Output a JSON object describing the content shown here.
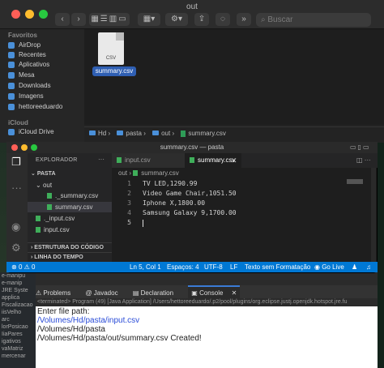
{
  "finder": {
    "title": "out",
    "search_placeholder": "Buscar",
    "sidebar_heading_favorites": "Favoritos",
    "favorites": [
      "AirDrop",
      "Recentes",
      "Aplicativos",
      "Mesa",
      "Downloads",
      "Imagens",
      "hettoreeduardo"
    ],
    "sidebar_heading_icloud": "iCloud",
    "icloud_items": [
      "iCloud Drive"
    ],
    "file_name": "summary.csv",
    "file_ext": "CSV",
    "path": [
      "Hd",
      "pasta",
      "out",
      "summary.csv"
    ]
  },
  "vscode": {
    "title": "summary.csv — pasta",
    "explorer": {
      "heading": "EXPLORADOR",
      "root": "PASTA",
      "tree": [
        {
          "label": "out",
          "type": "folder"
        },
        {
          "label": "._summary.csv",
          "type": "file"
        },
        {
          "label": "summary.csv",
          "type": "file"
        },
        {
          "label": "._input.csv",
          "type": "file"
        },
        {
          "label": "input.csv",
          "type": "file"
        }
      ],
      "outline": "ESTRUTURA DO CÓDIGO",
      "timeline": "LINHA DO TEMPO"
    },
    "tabs": [
      {
        "label": "input.csv",
        "active": false
      },
      {
        "label": "summary.csv",
        "active": true
      }
    ],
    "breadcrumb": [
      "out",
      "summary.csv"
    ],
    "lines": [
      "TV LED,1290.99",
      "Video Game Chair,1051.50",
      "Iphone X,1800.00",
      "Samsung Galaxy 9,1700.00",
      ""
    ],
    "line_numbers": [
      "1",
      "2",
      "3",
      "4",
      "5"
    ],
    "status": {
      "errors": "0",
      "warnings": "0",
      "position": "Ln 5, Col 1",
      "spaces": "Espaços: 4",
      "encoding": "UTF-8",
      "eol": "LF",
      "language": "Texto sem Formatação",
      "golive": "Go Live"
    }
  },
  "eclipse": {
    "tabs": [
      "Problems",
      "Javadoc",
      "Declaration",
      "Console"
    ],
    "active_tab": "Console",
    "terminated": "<terminated> Program (49) [Java Application] /Users/hettoreeduardo/.p2/pool/plugins/org.eclipse.justj.openjdk.hotspot.jre.fu",
    "console_lines": [
      "Enter file path:",
      "/Volumes/Hd/pasta/input.csv",
      "/Volumes/Hd/pasta",
      "/Volumes/Hd/pasta/out/summary.csv Created!"
    ],
    "left_panel_lines": [
      "e-manipu",
      "e-manip",
      "JRE Syste",
      "",
      "applica",
      "Fiscalizacao",
      "iisVelho",
      "arc",
      "lorPosicao",
      "IiaPares",
      "igativos",
      "vaMatriz",
      "mercenar"
    ]
  },
  "colors": {
    "accent": "#0078d4",
    "file_icon": "#3fae5a",
    "finder_selection": "#2f5fb3"
  }
}
